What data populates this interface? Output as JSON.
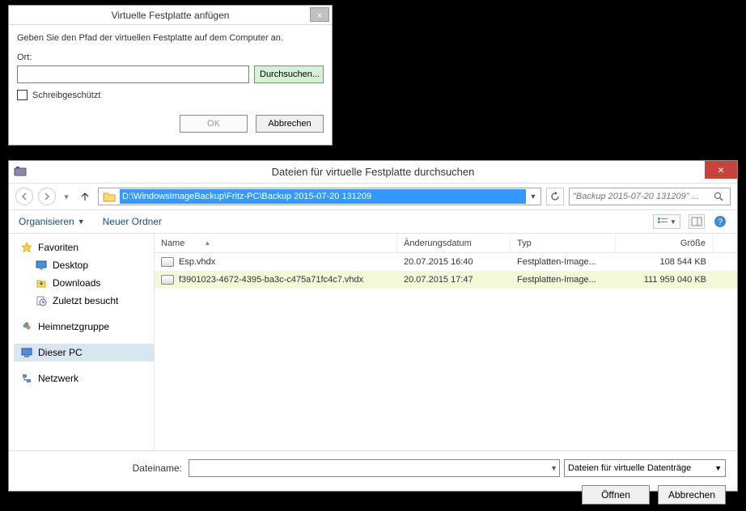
{
  "dlg1": {
    "title": "Virtuelle Festplatte anfügen",
    "desc": "Geben Sie den Pfad der virtuellen Festplatte auf dem Computer an.",
    "loc_label": "Ort:",
    "path_value": "",
    "browse": "Durchsuchen...",
    "readonly_label": "Schreibgeschützt",
    "readonly_checked": false,
    "ok": "OK",
    "cancel": "Abbrechen"
  },
  "dlg2": {
    "title": "Dateien für virtuelle Festplatte durchsuchen",
    "address": "D:\\WindowsImageBackup\\Fritz-PC\\Backup 2015-07-20 131209",
    "search_placeholder": "\"Backup 2015-07-20 131209\" ...",
    "toolbar": {
      "organize": "Organisieren",
      "new_folder": "Neuer Ordner"
    },
    "tree": {
      "favorites": "Favoriten",
      "desktop": "Desktop",
      "downloads": "Downloads",
      "recent": "Zuletzt besucht",
      "homegroup": "Heimnetzgruppe",
      "thispc": "Dieser PC",
      "network": "Netzwerk"
    },
    "columns": {
      "name": "Name",
      "date": "Änderungsdatum",
      "type": "Typ",
      "size": "Größe"
    },
    "rows": [
      {
        "name": "Esp.vhdx",
        "date": "20.07.2015 16:40",
        "type": "Festplatten-Image...",
        "size": "108 544 KB",
        "selected": false
      },
      {
        "name": "f3901023-4672-4395-ba3c-c475a71fc4c7.vhdx",
        "date": "20.07.2015 17:47",
        "type": "Festplatten-Image...",
        "size": "111 959 040 KB",
        "selected": true
      }
    ],
    "filename_label": "Dateiname:",
    "filename_value": "",
    "filter": "Dateien für virtuelle Datenträge",
    "open": "Öffnen",
    "cancel": "Abbrechen"
  }
}
